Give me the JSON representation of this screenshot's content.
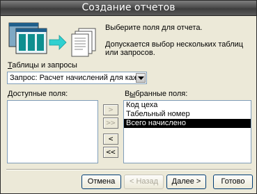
{
  "window": {
    "title": "Создание отчетов"
  },
  "info": {
    "line1": "Выберите поля для отчета.",
    "line2": "Допускается выбор нескольких таблиц или запросов."
  },
  "tables": {
    "label_u": "Т",
    "label_rest": "аблицы и запросы",
    "selected": "Запрос: Расчет начислений для каждого работ"
  },
  "available": {
    "label_u": "Д",
    "label_rest": "оступные поля:",
    "items": []
  },
  "selected_fields": {
    "label_pre": "В",
    "label_u": "ы",
    "label_rest": "бранные поля:",
    "items": [
      "Код цеха",
      "Табельный номер",
      "Всего начислено"
    ],
    "selected_index": 2
  },
  "move": {
    "add_one": ">",
    "add_all": ">>",
    "remove_one": "<",
    "remove_all": "<<"
  },
  "buttons": {
    "cancel": "Отмена",
    "back": "< Назад",
    "next": "Далее >",
    "finish": "Готово"
  }
}
